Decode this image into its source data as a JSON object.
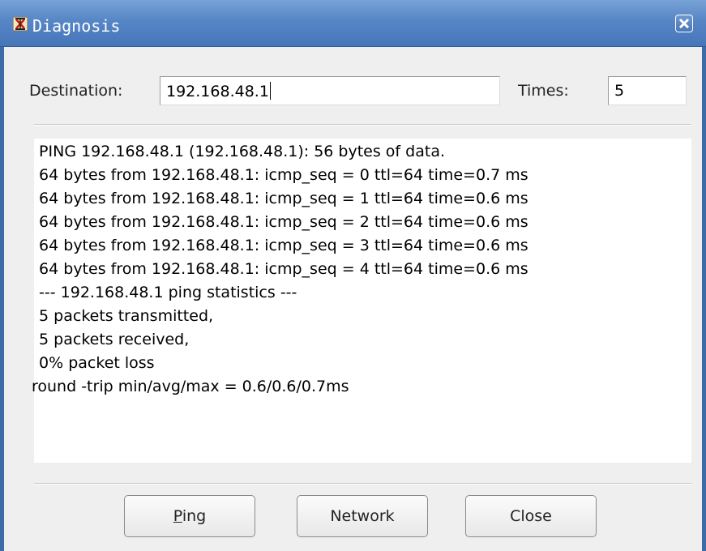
{
  "window": {
    "title": "Diagnosis",
    "titlebar_color": "#5686c6"
  },
  "form": {
    "destination_label": "Destination:",
    "destination_value": "192.168.48.1",
    "times_label": "Times:",
    "times_value": "5"
  },
  "output": {
    "lines": [
      " PING 192.168.48.1 (192.168.48.1): 56 bytes of data.",
      " 64 bytes from 192.168.48.1: icmp_seq = 0 ttl=64 time=0.7 ms",
      " 64 bytes from 192.168.48.1: icmp_seq = 1 ttl=64 time=0.6 ms",
      " 64 bytes from 192.168.48.1: icmp_seq = 2 ttl=64 time=0.6 ms",
      " 64 bytes from 192.168.48.1: icmp_seq = 3 ttl=64 time=0.6 ms",
      " 64 bytes from 192.168.48.1: icmp_seq = 4 ttl=64 time=0.6 ms",
      " --- 192.168.48.1 ping statistics ---",
      " 5 packets transmitted,",
      " 5 packets received,",
      " 0% packet loss",
      "round -trip min/avg/max = 0.6/0.6/0.7ms"
    ]
  },
  "buttons": {
    "ping_mnemonic": "P",
    "ping_rest": "ing",
    "network": "Network",
    "close": "Close"
  }
}
